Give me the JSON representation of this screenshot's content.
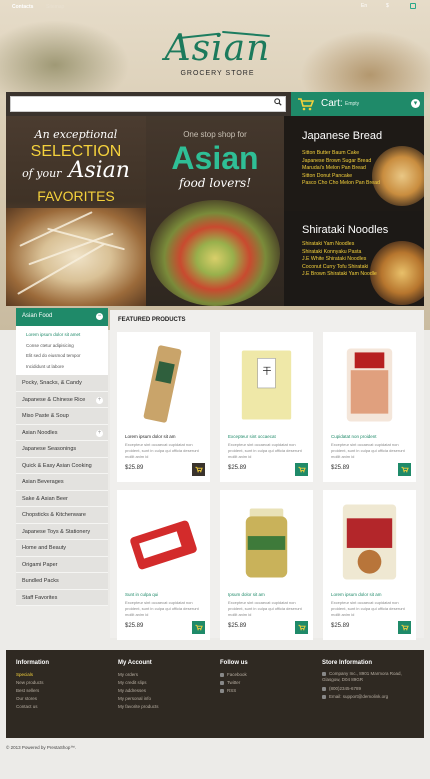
{
  "topbar": {
    "contacts": "Contacts",
    "sitemap": "Sitemap",
    "lang": "En",
    "currency": "$"
  },
  "logo": {
    "word": "Asian",
    "sub": "GROCERY STORE"
  },
  "search": {
    "placeholder": ""
  },
  "cart": {
    "label": "Cart:",
    "status": "Empty"
  },
  "banners": {
    "left": {
      "l1": "An exceptional",
      "l2": "SELECTION",
      "l3a": "of your",
      "l3b": "Asian",
      "l4": "FAVORITES"
    },
    "middle": {
      "l1": "One stop shop for",
      "l2": "Asian",
      "l3": "food lovers!"
    },
    "bread": {
      "title": "Japanese Bread",
      "items": [
        "Sitton Butter Baum Cake",
        "Japanese Brown Sugar Bread",
        "Marudai's Melon Pan Bread",
        "Sitton Donut Pancake",
        "Pasco Cho Cho Melon Pan Bread"
      ]
    },
    "noodles": {
      "title": "Shirataki Noodles",
      "items": [
        "Shirataki Yam Noodles",
        "Shirataki Konnyaku Pasta",
        "J.E White Shirataki Noodles",
        "Coconut Curry Tofu Shirataki",
        "J.E Brown Shirataki Yam Noodle"
      ]
    }
  },
  "sidebar": {
    "active": "Asian Food",
    "sub": [
      "Lorem ipsum dolor sit amet",
      "Conse ctetur adipisicing",
      "Elit sed do eiusmod tempor",
      "Incididunt ut labore"
    ],
    "items": [
      {
        "label": "Pocky, Snacks, & Candy",
        "plus": false
      },
      {
        "label": "Japanese & Chinese Rice",
        "plus": true
      },
      {
        "label": "Miso Paste & Soup",
        "plus": false
      },
      {
        "label": "Asian Noodles",
        "plus": true
      },
      {
        "label": "Japanese Seasonings",
        "plus": false
      },
      {
        "label": "Quick & Easy Asian Cooking",
        "plus": false
      },
      {
        "label": "Asian Beverages",
        "plus": false
      },
      {
        "label": "Sake & Asian Beer",
        "plus": false
      },
      {
        "label": "Chopsticks & Kitchenware",
        "plus": false
      },
      {
        "label": "Japanese Toys & Stationery",
        "plus": false
      },
      {
        "label": "Home and Beauty",
        "plus": false
      },
      {
        "label": "Origami Paper",
        "plus": false
      },
      {
        "label": "Bundled Packs",
        "plus": false
      },
      {
        "label": "Staff Favorites",
        "plus": false
      }
    ]
  },
  "featured": {
    "title": "FEATURED PRODUCTS",
    "products": [
      {
        "name": "Lorem ipsum dolor sit am",
        "desc": "Excepteur sint occaecat cupidatat non proident, sunt in culpa qui officia deserunt mollit anim id",
        "price": "$25.89"
      },
      {
        "name": "Excepteur sint occaecat",
        "desc": "Excepteur sint occaecat cupidatat non proident, sunt in culpa qui officia deserunt mollit anim id",
        "price": "$25.89"
      },
      {
        "name": "Cupidatat non proident",
        "desc": "Excepteur sint occaecat cupidatat non proident, sunt in culpa qui officia deserunt mollit anim id",
        "price": "$25.89"
      },
      {
        "name": "Sunt in culpa qui",
        "desc": "Excepteur sint occaecat cupidatat non proident, sunt in culpa qui officia deserunt mollit anim id",
        "price": "$25.89"
      },
      {
        "name": "Ipsum dolor sit am",
        "desc": "Excepteur sint occaecat cupidatat non proident, sunt in culpa qui officia deserunt mollit anim id",
        "price": "$25.89"
      },
      {
        "name": "Lorem ipsum dolor sit am",
        "desc": "Excepteur sint occaecat cupidatat non proident, sunt in culpa qui officia deserunt mollit anim id",
        "price": "$25.89"
      }
    ]
  },
  "footer": {
    "information": {
      "title": "Information",
      "items": [
        "Specials",
        "New products",
        "Best sellers",
        "Our stores",
        "Contact us"
      ]
    },
    "account": {
      "title": "My Account",
      "items": [
        "My orders",
        "My credit slips",
        "My addresses",
        "My personal info",
        "My favorite products"
      ]
    },
    "follow": {
      "title": "Follow us",
      "items": [
        "Facebook",
        "Twitter",
        "RSS"
      ]
    },
    "store": {
      "title": "Store Information",
      "items": [
        "Company Inc., 8901 Marmora Road, Glasgow, D04 89GR",
        "(800)2345-6789",
        "Email: support@demolink.org"
      ]
    }
  },
  "copyright": "© 2013 Powered by PrestaShop™.",
  "colors": {
    "accent": "#1f8a69",
    "dark": "#3a332d",
    "yellow": "#f4d13c"
  }
}
